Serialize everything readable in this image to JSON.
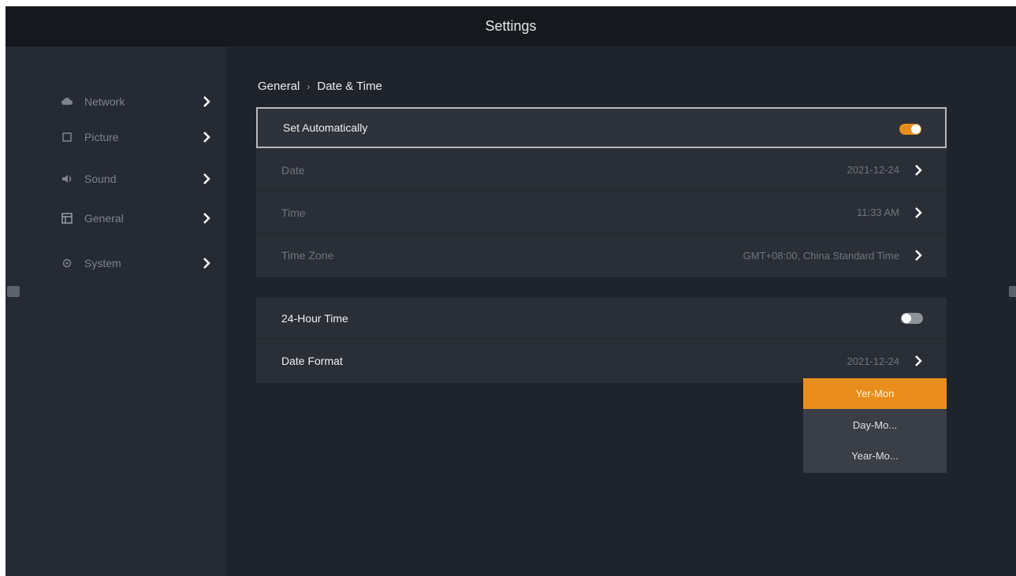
{
  "window": {
    "title": "Settings"
  },
  "sidebar": {
    "items": [
      {
        "label": "Network",
        "icon": "cloud-icon"
      },
      {
        "label": "Picture",
        "icon": "picture-icon"
      },
      {
        "label": "Sound",
        "icon": "speaker-icon"
      },
      {
        "label": "General",
        "icon": "general-icon"
      },
      {
        "label": "System",
        "icon": "system-icon"
      }
    ]
  },
  "breadcrumb": {
    "parent": "General",
    "separator": "›",
    "current": "Date & Time"
  },
  "panel1": {
    "set_automatically": {
      "label": "Set Automatically",
      "on": true
    },
    "date": {
      "label": "Date",
      "value": "2021-12-24"
    },
    "time": {
      "label": "Time",
      "value": "11:33 AM"
    },
    "time_zone": {
      "label": "Time Zone",
      "value": "GMT+08:00, China Standard Time"
    }
  },
  "panel2": {
    "hour24": {
      "label": "24-Hour Time",
      "on": false
    },
    "date_format": {
      "label": "Date Format",
      "value": "2021-12-24"
    }
  },
  "dropdown": {
    "options": [
      "Yer-Mon",
      "Day-Mo...",
      "Year-Mo..."
    ],
    "selected_index": 0
  },
  "colors": {
    "accent": "#e98e1c",
    "background": "#1f232b",
    "sidebar": "#262a33",
    "titlebar": "#15181d"
  }
}
